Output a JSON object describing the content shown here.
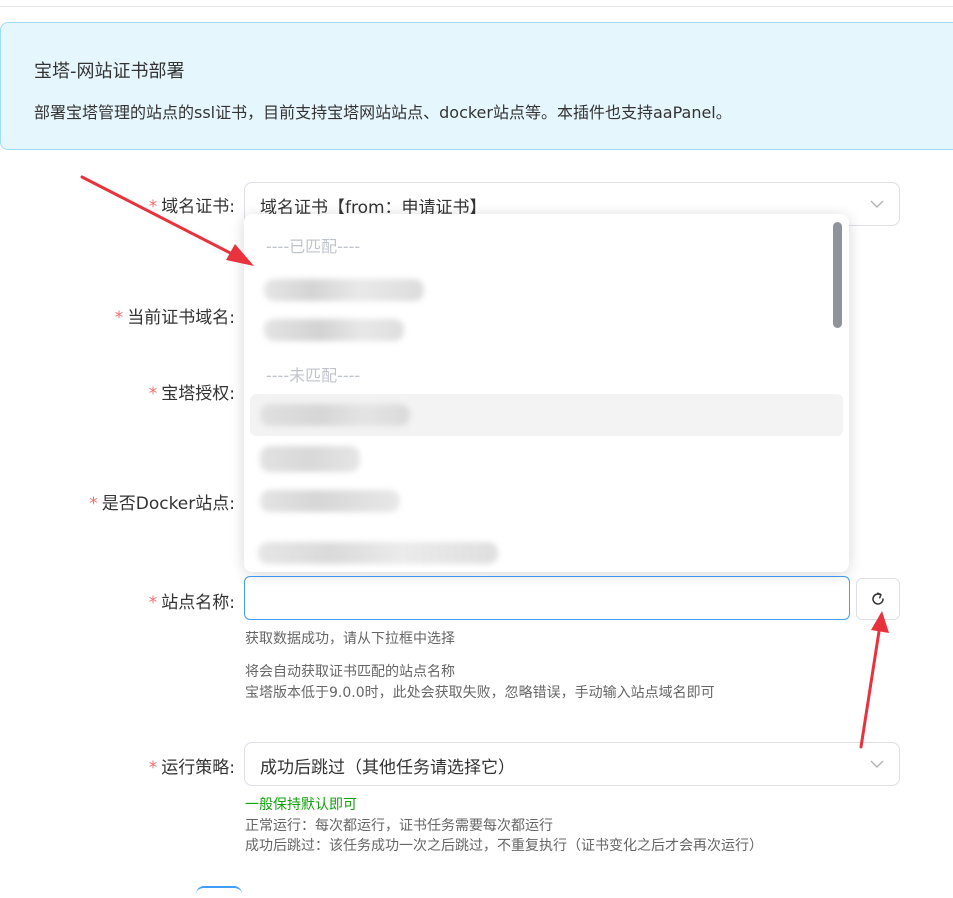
{
  "banner": {
    "title": "宝塔-网站证书部署",
    "description": "部署宝塔管理的站点的ssl证书，目前支持宝塔网站站点、docker站点等。本插件也支持aaPanel。"
  },
  "form": {
    "required_mark": "*",
    "cert_label": "域名证书:",
    "cert_value": "域名证书【from：申请证书】",
    "domain_label": "当前证书域名:",
    "auth_label": "宝塔授权:",
    "docker_label": "是否Docker站点:",
    "site_label": "站点名称:",
    "site_value": "",
    "site_help_success": "获取数据成功，请从下拉框中选择",
    "site_help_1": "将会自动获取证书匹配的站点名称",
    "site_help_2": "宝塔版本低于9.0.0时，此处会获取失败，忽略错误，手动输入站点域名即可",
    "strategy_label": "运行策略:",
    "strategy_value": "成功后跳过（其他任务请选择它）",
    "strategy_help_green": "一般保持默认即可",
    "strategy_help_1": "正常运行：每次都运行，证书任务需要每次都运行",
    "strategy_help_2": "成功后跳过：该任务成功一次之后跳过，不重复执行（证书变化之后才会再次运行）"
  },
  "dropdown": {
    "group_matched": "----已匹配----",
    "group_unmatched": "----未匹配----"
  },
  "icons": {
    "chevron": "chevron-down-icon",
    "refresh": "refresh-icon"
  },
  "colors": {
    "required": "#f56c6c",
    "focus_border": "#409eff",
    "hint_green": "#12a10e",
    "arrow_red": "#e8323c",
    "banner_bg": "#e6f6fd"
  }
}
